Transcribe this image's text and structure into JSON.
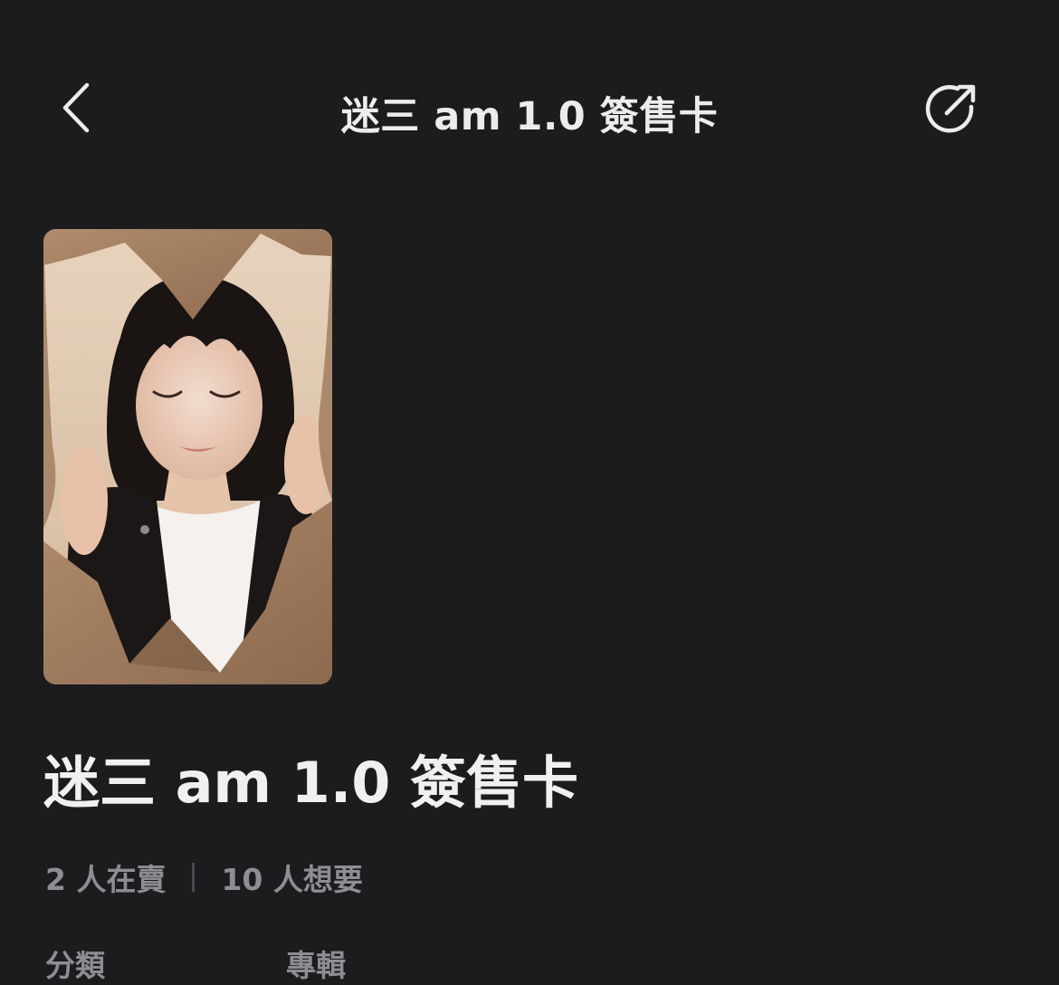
{
  "header": {
    "title": "迷三 am 1.0 簽售卡"
  },
  "product": {
    "title": "迷三 am 1.0 簽售卡",
    "selling_count": "2 人在賣",
    "wanting_count": "10 人想要"
  },
  "footer_partial": {
    "label": "分類",
    "value": "專輯"
  },
  "icons": {
    "back": "chevron-left-icon",
    "share": "share-arrow-icon"
  },
  "colors": {
    "background": "#1c1c1e",
    "title_text": "#ececec",
    "secondary_text": "#8d8d93"
  }
}
